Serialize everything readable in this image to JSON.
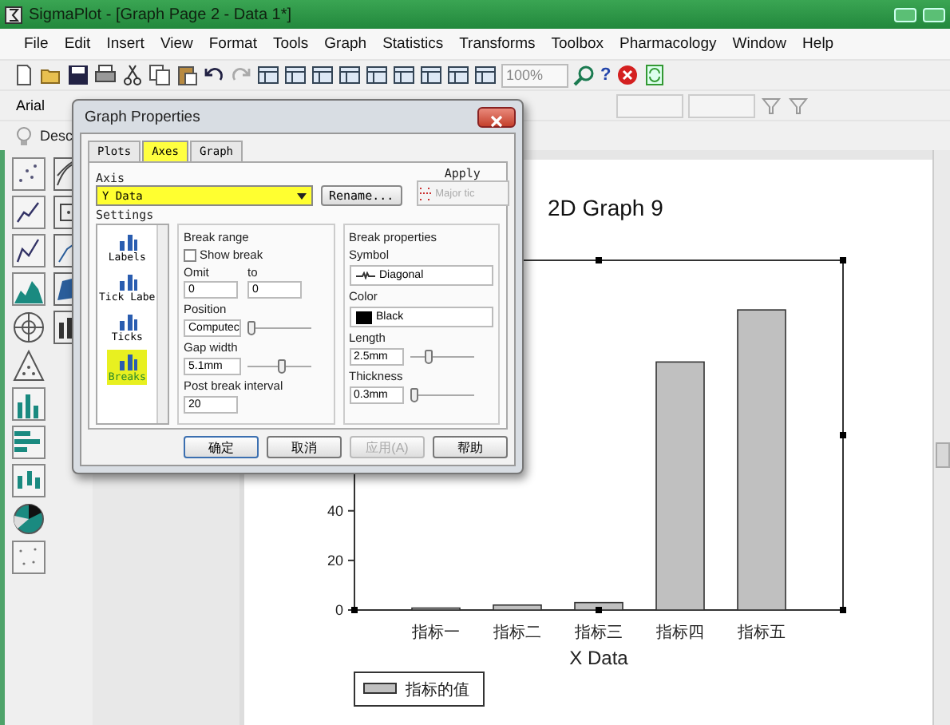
{
  "window": {
    "title": "SigmaPlot - [Graph Page 2 - Data 1*]"
  },
  "menu": [
    "File",
    "Edit",
    "Insert",
    "View",
    "Format",
    "Tools",
    "Graph",
    "Statistics",
    "Transforms",
    "Toolbox",
    "Pharmacology",
    "Window",
    "Help"
  ],
  "toolbar": {
    "zoom": "100%",
    "help": "?",
    "font": "Arial",
    "description": "Desc"
  },
  "dialog": {
    "title": "Graph Properties",
    "tabs": [
      {
        "label": "Plots",
        "selected": false
      },
      {
        "label": "Axes",
        "selected": true
      },
      {
        "label": "Graph",
        "selected": false
      }
    ],
    "axis_label": "Axis",
    "axis": "Y Data",
    "rename": "Rename...",
    "apply_label": "Apply",
    "apply": {
      "value": "Major tic",
      "disabled": true
    },
    "settings_label": "Settings",
    "settings": [
      {
        "label": "Labels",
        "selected": false
      },
      {
        "label": "Tick Labe",
        "selected": false
      },
      {
        "label": "Ticks",
        "selected": false
      },
      {
        "label": "Breaks",
        "selected": true
      }
    ],
    "break_range": {
      "title": "Break range",
      "show_break": {
        "label": "Show break",
        "checked": false
      },
      "omit_label": "Omit",
      "omit": "0",
      "to_label": "to",
      "to": "0",
      "position_label": "Position",
      "position": "Computec",
      "position_slider": {
        "level": 0
      },
      "gap_label": "Gap width",
      "gap": "5.1mm",
      "gap_slider": {
        "level": 0.55
      },
      "interval_label": "Post break interval",
      "interval": "20"
    },
    "break_properties": {
      "title": "Break properties",
      "symbol_label": "Symbol",
      "symbol": "Diagonal",
      "color_label": "Color",
      "color_name": "Black",
      "color": "#000000",
      "length_label": "Length",
      "length": "2.5mm",
      "length_slider": {
        "level": 0.28
      },
      "thickness_label": "Thickness",
      "thickness": "0.3mm",
      "thickness_slider": {
        "level": 0.02
      }
    },
    "buttons": [
      {
        "label": "确定",
        "disabled": false
      },
      {
        "label": "取消",
        "disabled": false
      },
      {
        "label": "应用(A)",
        "disabled": true
      },
      {
        "label": "帮助",
        "disabled": false
      }
    ]
  },
  "graph": {
    "legend": "指标的值",
    "chart_data": {
      "type": "bar",
      "title": "2D Graph 9",
      "xlabel": "X Data",
      "categories": [
        "指标一",
        "指标二",
        "指标三",
        "指标四",
        "指标五"
      ],
      "values": [
        0.8,
        2,
        3,
        100,
        121
      ],
      "ylim": [
        0,
        141
      ],
      "yticks": [
        0,
        20,
        40
      ]
    }
  }
}
